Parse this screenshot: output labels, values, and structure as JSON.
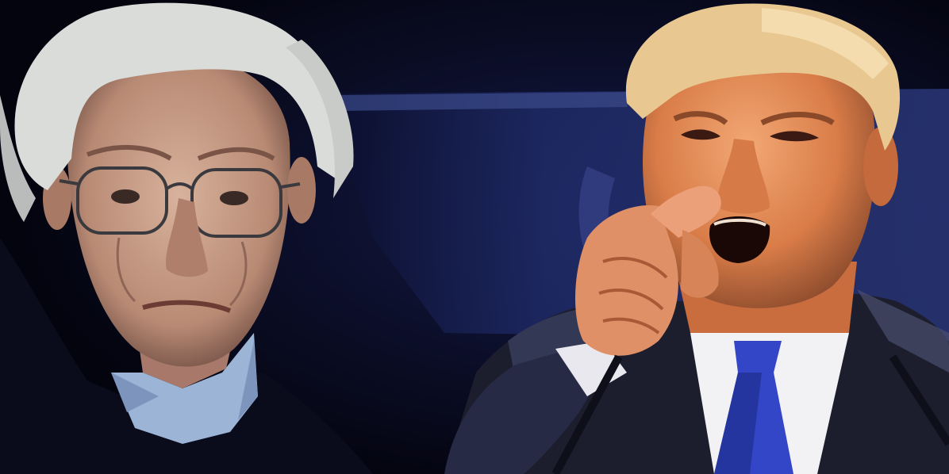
{
  "image": {
    "kind": "photo-composite",
    "subjects": [
      {
        "id": "left-portrait"
      },
      {
        "id": "right-portrait"
      }
    ],
    "colors": {
      "background": "#06061a",
      "stage_blue": "#1a2560",
      "stage_highlight": "#3a4a8a",
      "skin_left": "#c9a08a",
      "hair_left": "#d9dcd8",
      "skin_right": "#e08a56",
      "hair_right": "#e8c890",
      "shirt_left": "#9cb4d6",
      "sweater_left": "#0a0c1c",
      "suit_right": "#1c1e2e",
      "shirt_right": "#f2f2f4",
      "tie_right": "#3346c8"
    }
  }
}
